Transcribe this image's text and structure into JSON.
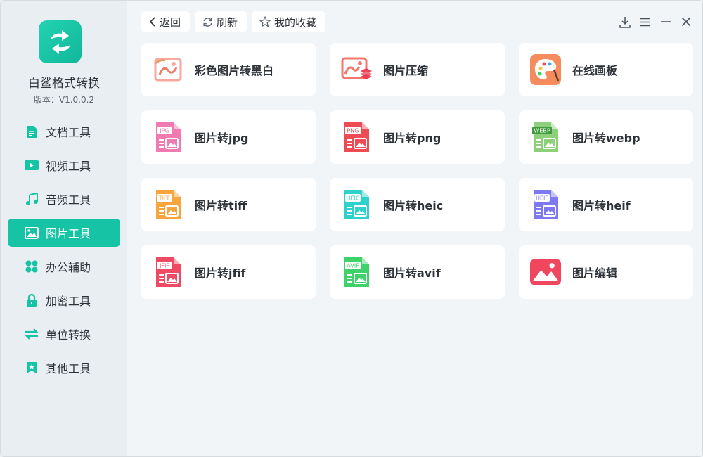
{
  "app": {
    "name": "白鲨格式转换",
    "version": "版本：V1.0.0.2"
  },
  "sidebar": {
    "items": [
      {
        "label": "文档工具",
        "icon": "document-icon"
      },
      {
        "label": "视频工具",
        "icon": "video-icon"
      },
      {
        "label": "音频工具",
        "icon": "music-icon"
      },
      {
        "label": "图片工具",
        "icon": "image-icon",
        "active": true
      },
      {
        "label": "办公辅助",
        "icon": "office-icon"
      },
      {
        "label": "加密工具",
        "icon": "lock-icon"
      },
      {
        "label": "单位转换",
        "icon": "swap-icon"
      },
      {
        "label": "其他工具",
        "icon": "bookmark-icon"
      }
    ]
  },
  "toolbar": {
    "back": "返回",
    "refresh": "刷新",
    "favorites": "我的收藏"
  },
  "tools": [
    {
      "label": "彩色图片转黑白",
      "icon": "color-to-bw-icon"
    },
    {
      "label": "图片压缩",
      "icon": "image-compress-icon"
    },
    {
      "label": "在线画板",
      "icon": "palette-icon"
    },
    {
      "label": "图片转jpg",
      "icon": "jpg-file-icon",
      "badge": "JPG",
      "color": "#f17bb0"
    },
    {
      "label": "图片转png",
      "icon": "png-file-icon",
      "badge": "PNG",
      "color": "#ef4b55"
    },
    {
      "label": "图片转webp",
      "icon": "webp-file-icon",
      "badge": "WEBP",
      "color": "#8dcf7a"
    },
    {
      "label": "图片转tiff",
      "icon": "tiff-file-icon",
      "badge": "TIFF",
      "color": "#f7a53c"
    },
    {
      "label": "图片转heic",
      "icon": "heic-file-icon",
      "badge": "HEIC",
      "color": "#2ed1cc"
    },
    {
      "label": "图片转heif",
      "icon": "heif-file-icon",
      "badge": "HEIF",
      "color": "#7e79f0"
    },
    {
      "label": "图片转jfif",
      "icon": "jfif-file-icon",
      "badge": "JFIF",
      "color": "#ef4a63"
    },
    {
      "label": "图片转avif",
      "icon": "avif-file-icon",
      "badge": "AVIF",
      "color": "#3fd26a"
    },
    {
      "label": "图片编辑",
      "icon": "image-edit-icon"
    }
  ],
  "colors": {
    "accent": "#16c3a4",
    "sidebar_bg": "#e9eef2",
    "content_bg": "#f2f5f8"
  }
}
